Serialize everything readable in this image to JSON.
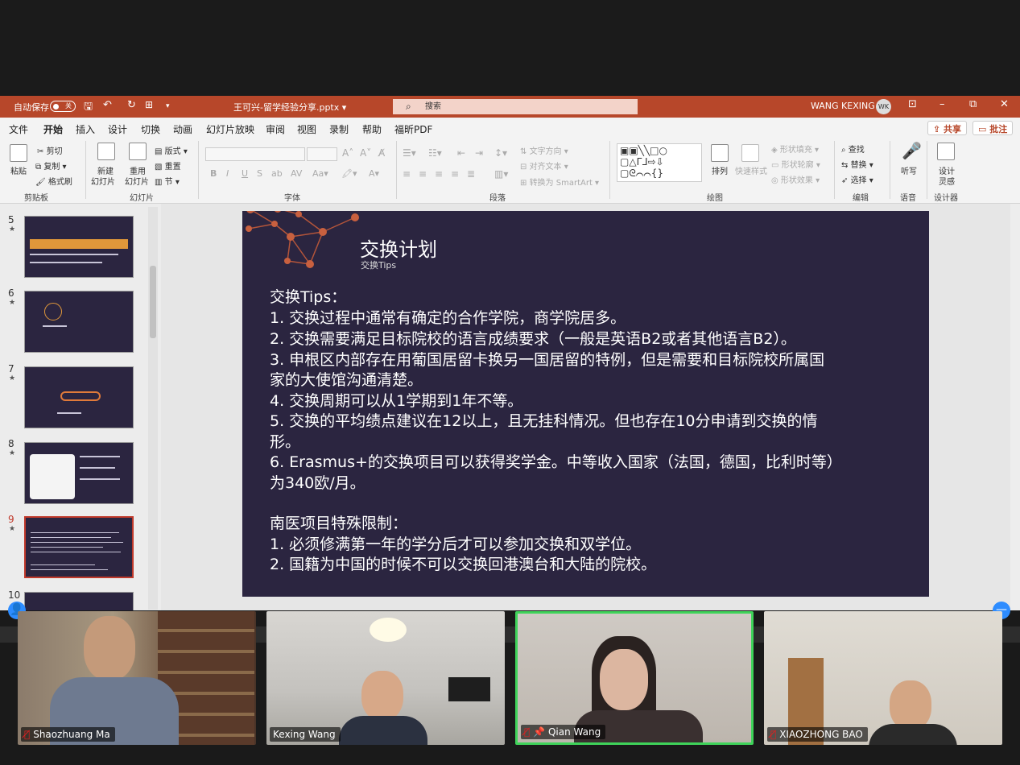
{
  "titlebar": {
    "autosave_label": "自动保存",
    "autosave_state": "关",
    "filename": "王可兴-留学经验分享.pptx",
    "search_placeholder": "搜索",
    "user_name": "WANG KEXING",
    "user_initials": "WK"
  },
  "menu": {
    "items": [
      "文件",
      "开始",
      "插入",
      "设计",
      "切换",
      "动画",
      "幻灯片放映",
      "审阅",
      "视图",
      "录制",
      "帮助",
      "福昕PDF"
    ],
    "share_label": "共享",
    "comment_label": "批注"
  },
  "ribbon": {
    "clipboard": {
      "paste": "粘贴",
      "cut": "剪切",
      "copy": "复制",
      "format_painter": "格式刷",
      "group": "剪贴板"
    },
    "slides": {
      "new_slide_1": "新建",
      "new_slide_2": "幻灯片",
      "reuse_1": "重用",
      "reuse_2": "幻灯片",
      "layout": "版式",
      "reset": "重置",
      "section": "节",
      "group": "幻灯片"
    },
    "font": {
      "group": "字体"
    },
    "paragraph": {
      "text_direction": "文字方向",
      "align_text": "对齐文本",
      "smartart": "转换为 SmartArt",
      "group": "段落"
    },
    "drawing": {
      "arrange": "排列",
      "quick_styles": "快速样式",
      "shape_fill": "形状填充",
      "shape_outline": "形状轮廓",
      "shape_effects": "形状效果",
      "group": "绘图"
    },
    "editing": {
      "find": "查找",
      "replace": "替换",
      "select": "选择",
      "group": "编辑"
    },
    "voice": {
      "dictate": "听写",
      "group": "语音"
    },
    "designer": {
      "label_1": "设计",
      "label_2": "灵感",
      "group": "设计器"
    }
  },
  "thumbnails": [
    {
      "num": "5"
    },
    {
      "num": "6"
    },
    {
      "num": "7"
    },
    {
      "num": "8"
    },
    {
      "num": "9",
      "selected": true
    },
    {
      "num": "10"
    }
  ],
  "slide": {
    "title": "交换计划",
    "subtitle": "交换Tips",
    "lines": [
      "交换Tips：",
      "1. 交换过程中通常有确定的合作学院，商学院居多。",
      "2. 交换需要满足目标院校的语言成绩要求（一般是英语B2或者其他语言B2）。",
      "3. 申根区内部存在用葡国居留卡换另一国居留的特例，但是需要和目标院校所属国",
      "家的大使馆沟通清楚。",
      "4. 交换周期可以从1学期到1年不等。",
      "5. 交换的平均绩点建议在12以上，且无挂科情况。但也存在10分申请到交换的情",
      "形。",
      "6. Erasmus+的交换项目可以获得奖学金。中等收入国家（法国，德国，比利时等）",
      "为340欧/月。",
      "南医项目特殊限制：",
      "1.  必须修满第一年的学分后才可以参加交换和双学位。",
      "2.  国籍为中国的时候不可以交换回港澳台和大陆的院校。"
    ]
  },
  "participants": [
    {
      "name": "Shaozhuang Ma",
      "muted": true
    },
    {
      "name": "Kexing Wang",
      "muted": false
    },
    {
      "name": "Qian Wang",
      "muted": true,
      "pinned": true,
      "active": true
    },
    {
      "name": "XIAOZHONG BAO",
      "muted": true
    }
  ],
  "colors": {
    "ppt_red": "#b7472a",
    "slide_bg": "#2b2540",
    "active_speaker": "#3fd35a",
    "zoom_blue": "#2d8cff"
  }
}
